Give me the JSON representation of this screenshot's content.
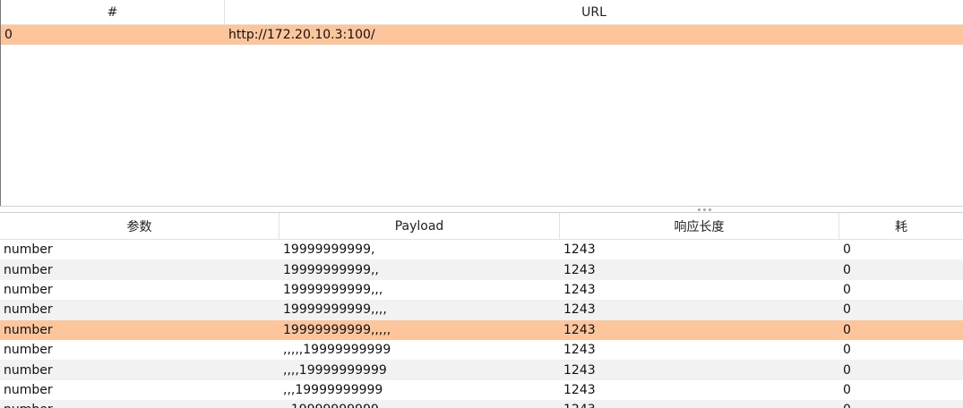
{
  "top_table": {
    "columns": [
      "#",
      "URL"
    ],
    "rows": [
      {
        "index": "0",
        "url": "http://172.20.10.3:100/",
        "selected": true
      }
    ]
  },
  "bottom_table": {
    "columns": [
      "参数",
      "Payload",
      "响应长度",
      "耗"
    ],
    "rows": [
      {
        "param": "number",
        "payload": "19999999999,",
        "length": "1243",
        "time": "0",
        "selected": false
      },
      {
        "param": "number",
        "payload": "19999999999,,",
        "length": "1243",
        "time": "0",
        "selected": false
      },
      {
        "param": "number",
        "payload": "19999999999,,,",
        "length": "1243",
        "time": "0",
        "selected": false
      },
      {
        "param": "number",
        "payload": "19999999999,,,,",
        "length": "1243",
        "time": "0",
        "selected": false
      },
      {
        "param": "number",
        "payload": "19999999999,,,,,",
        "length": "1243",
        "time": "0",
        "selected": true
      },
      {
        "param": "number",
        "payload": ",,,,,19999999999",
        "length": "1243",
        "time": "0",
        "selected": false
      },
      {
        "param": "number",
        "payload": ",,,,19999999999",
        "length": "1243",
        "time": "0",
        "selected": false
      },
      {
        "param": "number",
        "payload": ",,,19999999999",
        "length": "1243",
        "time": "0",
        "selected": false
      },
      {
        "param": "number",
        "payload": ",,19999999999",
        "length": "1243",
        "time": "0",
        "selected": false
      }
    ]
  },
  "colors": {
    "selected_row": "#fdc59b",
    "alt_row": "#f2f2f2",
    "divider": "#c9d3dd"
  }
}
